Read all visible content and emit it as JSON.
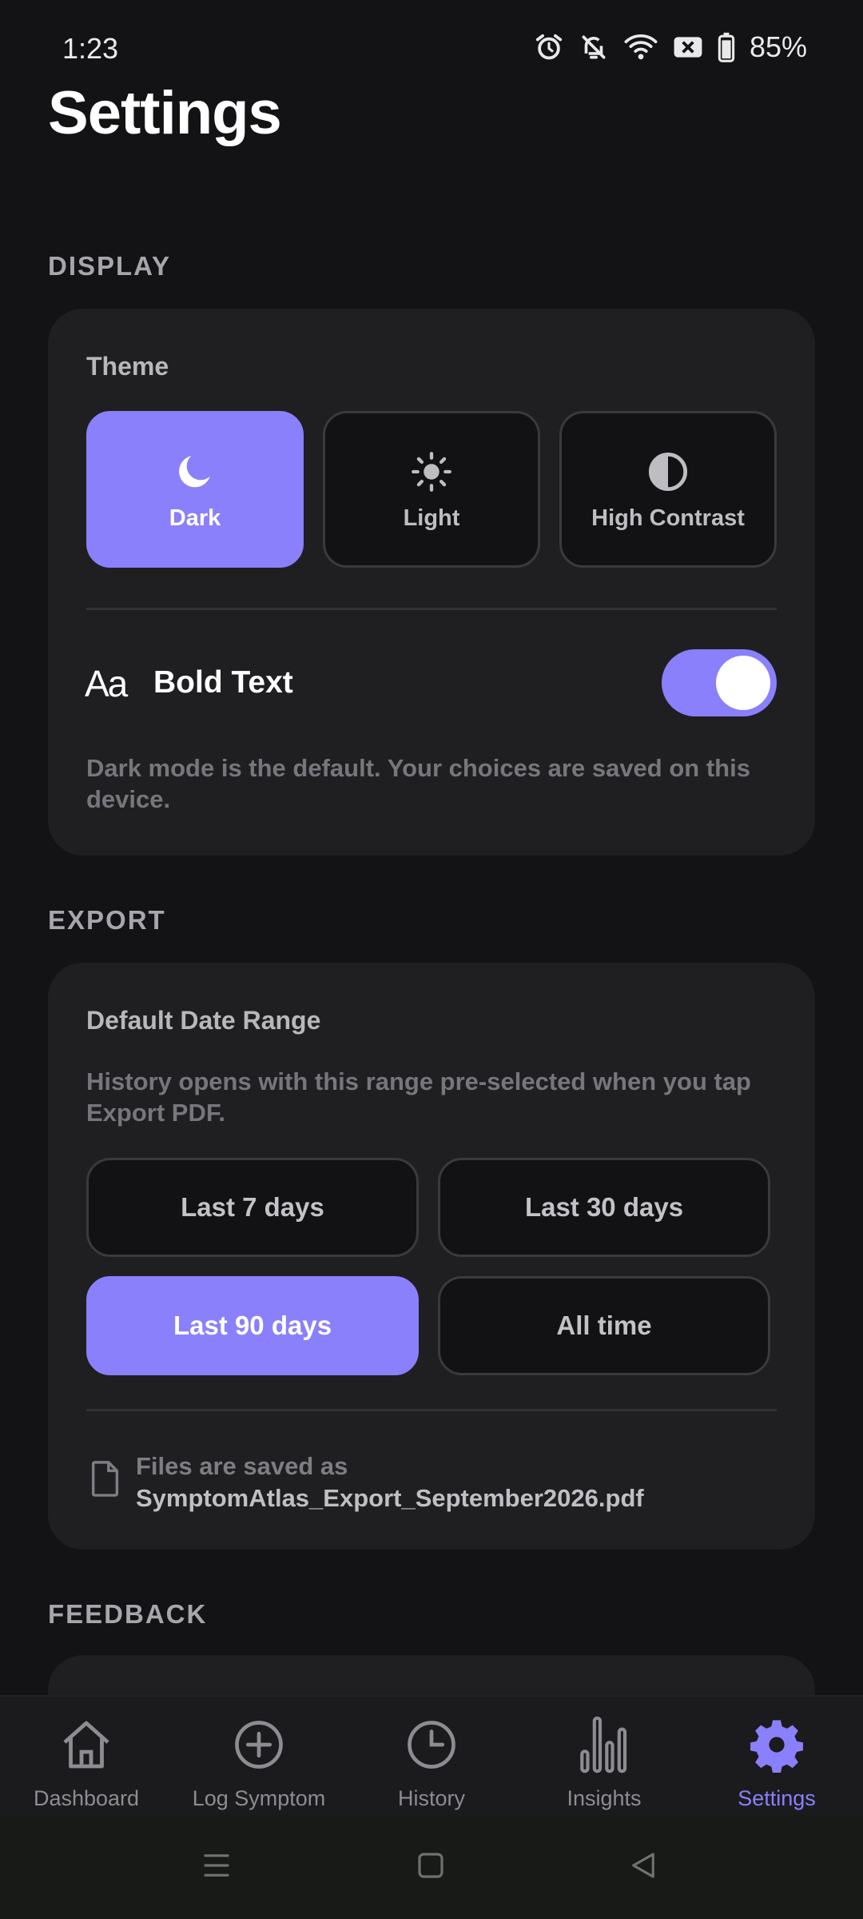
{
  "status_bar": {
    "time": "1:23",
    "battery": "85%"
  },
  "page_title": "Settings",
  "display": {
    "section_label": "DISPLAY",
    "theme_heading": "Theme",
    "themes": [
      {
        "label": "Dark",
        "icon": "moon-icon",
        "selected": true
      },
      {
        "label": "Light",
        "icon": "sun-icon",
        "selected": false
      },
      {
        "label": "High Contrast",
        "icon": "contrast-icon",
        "selected": false
      }
    ],
    "bold_text_icon": "Aa",
    "bold_text_label": "Bold Text",
    "bold_text_on": true,
    "note": "Dark mode is the default. Your choices are saved on this device."
  },
  "export": {
    "section_label": "EXPORT",
    "heading": "Default Date Range",
    "description": "History opens with this range pre-selected when you tap Export PDF.",
    "ranges": [
      {
        "label": "Last 7 days",
        "selected": false
      },
      {
        "label": "Last 30 days",
        "selected": false
      },
      {
        "label": "Last 90 days",
        "selected": true
      },
      {
        "label": "All time",
        "selected": false
      }
    ],
    "file_lead": "Files are saved as",
    "file_name": "SymptomAtlas_Export_September2026.pdf"
  },
  "feedback": {
    "section_label": "FEEDBACK"
  },
  "nav": [
    {
      "label": "Dashboard",
      "icon": "home-icon",
      "active": false
    },
    {
      "label": "Log Symptom",
      "icon": "plus-circle-icon",
      "active": false
    },
    {
      "label": "History",
      "icon": "clock-icon",
      "active": false
    },
    {
      "label": "Insights",
      "icon": "bar-chart-icon",
      "active": false
    },
    {
      "label": "Settings",
      "icon": "gear-icon",
      "active": true
    }
  ],
  "colors": {
    "accent": "#8a80fb",
    "background": "#131315",
    "card": "#1f1f22"
  }
}
